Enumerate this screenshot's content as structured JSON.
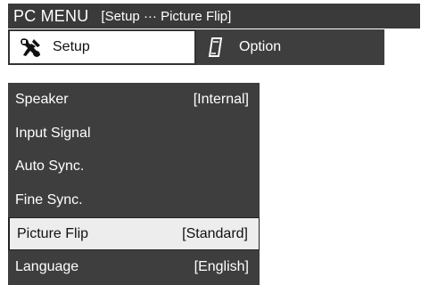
{
  "header": {
    "title": "PC MENU",
    "breadcrumb": "[Setup ··· Picture Flip]"
  },
  "tabs": [
    {
      "label": "Setup",
      "icon": "wrench-icon",
      "active": true
    },
    {
      "label": "Option",
      "icon": "option-icon",
      "active": false
    }
  ],
  "menu": {
    "items": [
      {
        "label": "Speaker",
        "value": "[Internal]"
      },
      {
        "label": "Input Signal",
        "value": ""
      },
      {
        "label": "Auto Sync.",
        "value": ""
      },
      {
        "label": "Fine Sync.",
        "value": ""
      },
      {
        "label": "Picture Flip",
        "value": "[Standard]",
        "selected": true
      },
      {
        "label": "Language",
        "value": "[English]"
      }
    ]
  },
  "colors": {
    "panel": "#3e3e3e",
    "title_bar": "#3a3a3a",
    "selected_bg": "#ededed"
  }
}
